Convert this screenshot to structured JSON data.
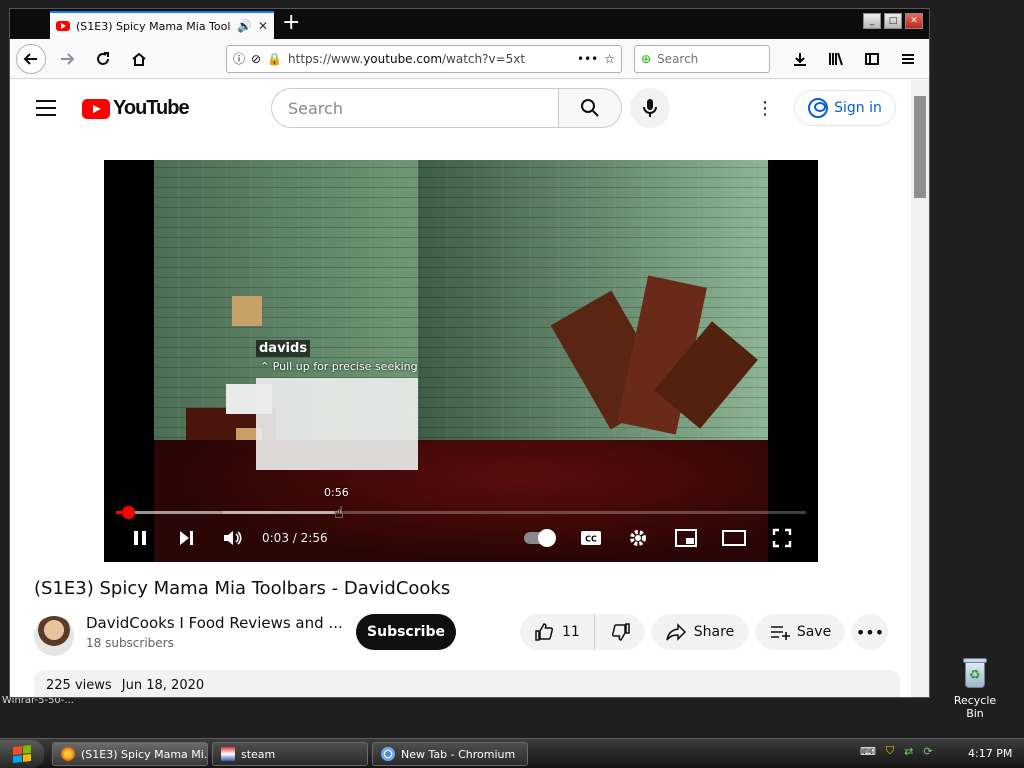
{
  "browser": {
    "tab_title": "(S1E3) Spicy Mama Mia Toolbars",
    "url_prefix": "https://www.",
    "url_domain": "youtube.com",
    "url_rest": "/watch?v=5xt",
    "search_placeholder": "Search"
  },
  "youtube": {
    "logo_text": "YouTube",
    "search_placeholder": "Search",
    "sign_in": "Sign in"
  },
  "player": {
    "name_tag": "davids",
    "seek_hint": "Pull up for precise seeking",
    "hover_time": "0:56",
    "current_time": "0:03",
    "separator": "/",
    "duration": "2:56",
    "progress_played": 0.017,
    "progress_loaded": 0.155,
    "progress_hover": 0.318
  },
  "video": {
    "title": "(S1E3) Spicy Mama Mia Toolbars - DavidCooks",
    "channel_name": "DavidCooks I Food Reviews and ...",
    "subscribers": "18 subscribers",
    "subscribe_label": "Subscribe",
    "likes": "11",
    "share_label": "Share",
    "save_label": "Save",
    "views": "225 views",
    "date": "Jun 18, 2020"
  },
  "desktop": {
    "recycle_bin": "Recycle Bin",
    "cut_label": "Winrar-5-50-..."
  },
  "taskbar": {
    "tasks": [
      {
        "label": "(S1E3) Spicy Mama Mi..."
      },
      {
        "label": "steam"
      },
      {
        "label": "New Tab - Chromium"
      }
    ],
    "clock": "4:17 PM"
  }
}
